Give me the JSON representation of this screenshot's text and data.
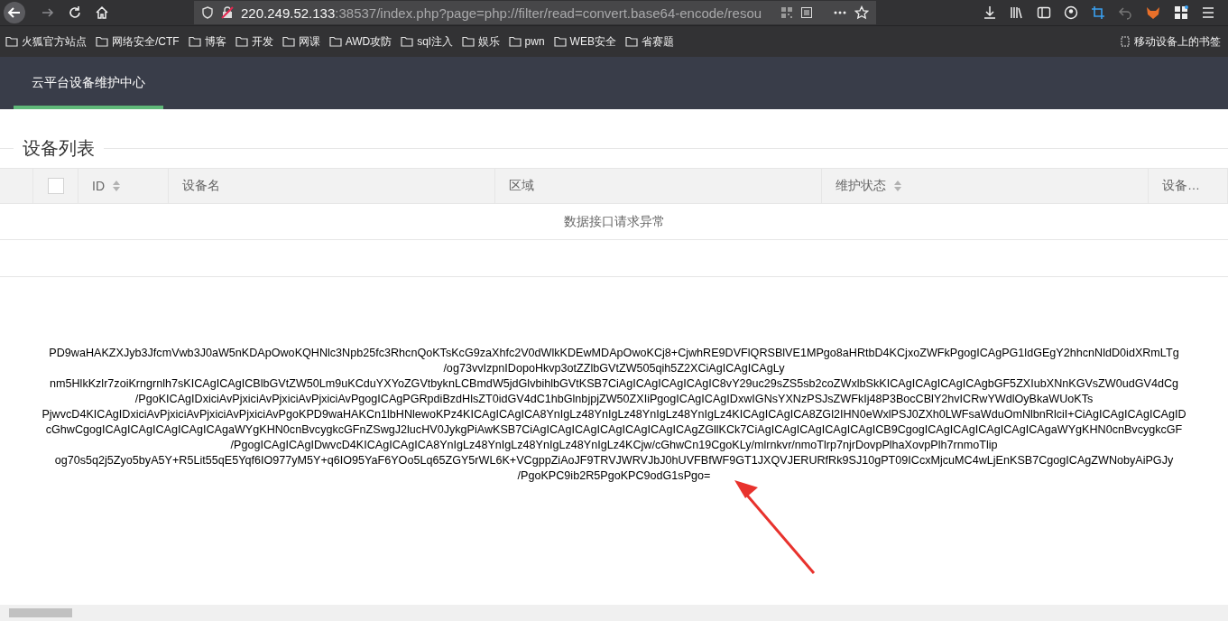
{
  "browser": {
    "url": {
      "host": "220.249.52.133",
      "rest": ":38537/index.php?page=php://filter/read=convert.base64-encode/resou"
    },
    "bookmarks": [
      "火狐官方站点",
      "网络安全/CTF",
      "博客",
      "开发",
      "网课",
      "AWD攻防",
      "sql注入",
      "娱乐",
      "pwn",
      "WEB安全",
      "省赛题"
    ],
    "mobile_bookmarks": "移动设备上的书签"
  },
  "app": {
    "nav": [
      {
        "label": "云平台设备维护中心",
        "selected": true
      }
    ],
    "section_title": "设备列表",
    "table": {
      "header_checkbox": {
        "checked": false
      },
      "columns": [
        {
          "label": "ID",
          "sortable": true
        },
        {
          "label": "设备名",
          "sortable": false
        },
        {
          "label": "区域",
          "sortable": false
        },
        {
          "label": "维护状态",
          "sortable": true
        },
        {
          "label": "设备…",
          "sortable": false
        }
      ],
      "empty_message": "数据接口请求异常"
    },
    "output_lines": [
      "PD9waHAKZXJyb3JfcmVwb3J0aW5nKDApOwoKQHNlc3Npb25fc3RhcnQoKTsKcG9zaXhfc2V0dWlkKDEwMDApOwoKCj8+CjwhRE9DVFlQRSBlVE1MPgo8aHRtbD4KCjxoZWFkPgogICAgPG1ldGEgY2hhcnNldD0idXRmLTg",
      "/og73vvIzpnIDopoHkvp3otZZlbGVtZW505qih5Z2XCiAgICAgICAgLy",
      "nm5HlkKzlr7zoiKrngrnlh7sKICAgICAgICBlbGVtZW50Lm9uKCduYXYoZGVtbyknLCBmdW5jdGlvbihlbGVtKSB7CiAgICAgICAgICAgIC8vY29uc29sZS5sb2coZWxlbSkKICAgICAgICAgICAgbGF5ZXIubXNnKGVsZW0udGV4dCg",
      "/PgoKICAgIDxiciAvPjxiciAvPjxiciAvPjxiciAvPgogICAgPGRpdiBzdHlsZT0idGV4dC1hbGlnbjpjZW50ZXIiPgogICAgICAgIDxwIGNsYXNzPSJsZWFkIj48P3BocCBlY2hvICRwYWdlOyBkaWUoKTs",
      "PjwvcD4KICAgIDxiciAvPjxiciAvPjxiciAvPjxiciAvPgoKPD9waHAKCn1lbHNlewoKPz4KICAgICAgICA8YnIgLz48YnIgLz48YnIgLz48YnIgLz4KICAgICAgICA8ZGl2IHN0eWxlPSJ0ZXh0LWFsaWduOmNlbnRlciI+CiAgICAgICAgICAgID",
      "cGhwCgogICAgICAgICAgICAgICAgaWYgKHN0cnBvcygkcGFnZSwgJ2lucHV0JykgPiAwKSB7CiAgICAgICAgICAgICAgICAgICAgZGllKCk7CiAgICAgICAgICAgICAgICB9CgogICAgICAgICAgICAgICAgaWYgKHN0cnBvcygkcGF",
      "/PgogICAgICAgIDwvcD4KICAgICAgICA8YnIgLz48YnIgLz48YnIgLz48YnIgLz4KCjw/cGhwCn19CgoKLy/mlrnkvr/nmoTlrp7njrDovpPlhaXovpPlh7rnmoTlip",
      "og70s5q2j5Zyo5byA5Y+R5Lit55qE5Yqf6IO977yM5Y+q6IO95YaF6YOo5Lq65ZGY5rWL6K+VCgppZiAoJF9TRVJWRVJbJ0hUVFBfWF9GT1JXQVJERURfRk9SJ10gPT09ICcxMjcuMC4wLjEnKSB7CgogICAgZWNobyAiPGJy",
      "/PgoKPC9ib2R5PgoKPC9odG1sPgo="
    ]
  }
}
